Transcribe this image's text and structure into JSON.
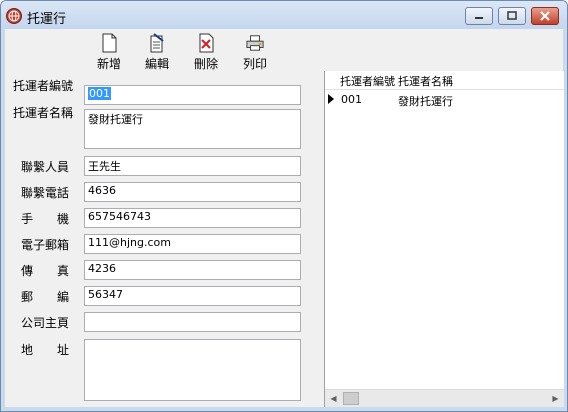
{
  "window": {
    "title": "托運行"
  },
  "toolbar": {
    "new_label": "新增",
    "edit_label": "編輯",
    "delete_label": "刪除",
    "print_label": "列印"
  },
  "form": {
    "fields": [
      {
        "label": "托運者編號",
        "value": "001"
      },
      {
        "label": "托運者名稱",
        "value": "發財托運行"
      },
      {
        "label": "聯繫人員",
        "value": "王先生"
      },
      {
        "label": "聯繫電話",
        "value": "4636"
      },
      {
        "label": "手　　機",
        "value": "657546743"
      },
      {
        "label": "電子郵箱",
        "value": "111@hjng.com"
      },
      {
        "label": "傳　　真",
        "value": "4236"
      },
      {
        "label": "郵　　編",
        "value": "56347"
      },
      {
        "label": "公司主頁",
        "value": ""
      },
      {
        "label": "地　　址",
        "value": ""
      }
    ]
  },
  "grid": {
    "columns": [
      "托運者編號",
      "托運者名稱"
    ],
    "rows": [
      {
        "id": "001",
        "name": "發財托運行"
      }
    ]
  },
  "colors": {
    "selection": "#3399ff",
    "title_bg": "#c9daef"
  },
  "icons": [
    "globe-icon",
    "minimize-icon",
    "maximize-icon",
    "close-icon",
    "new-document-icon",
    "edit-document-icon",
    "delete-document-icon",
    "printer-icon",
    "row-indicator-icon"
  ]
}
